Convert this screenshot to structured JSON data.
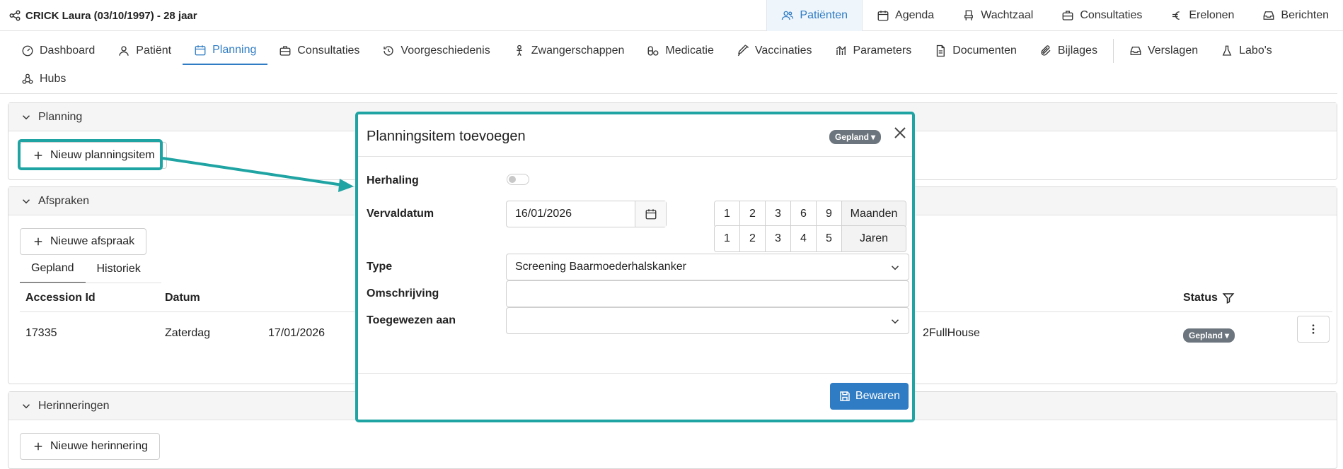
{
  "header": {
    "patient": "CRICK Laura (03/10/1997) - 28 jaar",
    "tabs": [
      {
        "label": "Patiënten",
        "icon": "users-icon",
        "active": true
      },
      {
        "label": "Agenda",
        "icon": "calendar-icon"
      },
      {
        "label": "Wachtzaal",
        "icon": "chair-icon"
      },
      {
        "label": "Consultaties",
        "icon": "briefcase-icon"
      },
      {
        "label": "Erelonen",
        "icon": "euro-icon"
      },
      {
        "label": "Berichten",
        "icon": "inbox-icon"
      }
    ]
  },
  "subtabs": [
    {
      "label": "Dashboard",
      "icon": "dashboard-icon"
    },
    {
      "label": "Patiënt",
      "icon": "user-icon"
    },
    {
      "label": "Planning",
      "icon": "calendar-icon",
      "active": true
    },
    {
      "label": "Consultaties",
      "icon": "briefcase-icon"
    },
    {
      "label": "Voorgeschiedenis",
      "icon": "history-icon"
    },
    {
      "label": "Zwangerschappen",
      "icon": "baby-icon"
    },
    {
      "label": "Medicatie",
      "icon": "pills-icon"
    },
    {
      "label": "Vaccinaties",
      "icon": "syringe-icon"
    },
    {
      "label": "Parameters",
      "icon": "chart-icon"
    },
    {
      "label": "Documenten",
      "icon": "document-icon"
    },
    {
      "label": "Bijlages",
      "icon": "paperclip-icon"
    },
    {
      "label": "Verslagen",
      "icon": "inbox-icon"
    },
    {
      "label": "Labo's",
      "icon": "flask-icon"
    },
    {
      "label": "Hubs",
      "icon": "hubs-icon"
    }
  ],
  "planning": {
    "title": "Planning",
    "new_button": "Nieuw planningsitem"
  },
  "afspraken": {
    "title": "Afspraken",
    "new_button": "Nieuwe afspraak",
    "tabs": [
      "Gepland",
      "Historiek"
    ],
    "columns": {
      "id": "Accession Id",
      "date": "Datum",
      "status": "Status"
    },
    "row": {
      "id": "17335",
      "day": "Zaterdag",
      "date": "17/01/2026",
      "location": "2FullHouse",
      "status": "Gepland"
    }
  },
  "herinneringen": {
    "title": "Herinneringen",
    "new_button": "Nieuwe herinnering"
  },
  "modal": {
    "title": "Planningsitem toevoegen",
    "badge": "Gepland",
    "labels": {
      "herhaling": "Herhaling",
      "vervaldatum": "Vervaldatum",
      "type": "Type",
      "omschrijving": "Omschrijving",
      "toegewezen": "Toegewezen aan"
    },
    "vervaldatum": "16/01/2026",
    "maanden": [
      "1",
      "2",
      "3",
      "6",
      "9"
    ],
    "maanden_label": "Maanden",
    "jaren": [
      "1",
      "2",
      "3",
      "4",
      "5"
    ],
    "jaren_label": "Jaren",
    "type": "Screening Baarmoederhalskanker",
    "omschrijving": "",
    "toegewezen": "",
    "save": "Bewaren"
  },
  "colors": {
    "accent": "#2f7cc4",
    "highlight": "#1fa3a3",
    "badge": "#6c757d"
  }
}
